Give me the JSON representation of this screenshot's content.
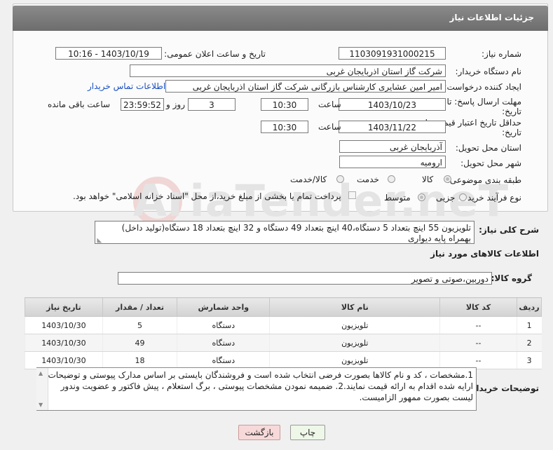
{
  "header": {
    "title": "جزئیات اطلاعات نیاز"
  },
  "form": {
    "need_number_label": "شماره نیاز:",
    "need_number": "1103091931000215",
    "announce_label": "تاریخ و ساعت اعلان عمومی:",
    "announce_value": "1403/10/19 - 10:16",
    "buyer_org_label": "نام دستگاه خریدار:",
    "buyer_org": "شرکت گاز استان اذربایجان غربی",
    "creator_label": "ایجاد کننده درخواست:",
    "creator": "امیر امین عشایری کارشناس بازرگانی شرکت گاز استان اذربایجان غربی",
    "contact_link": "اطلاعات تماس خریدار",
    "reply_deadline_label": "مهلت ارسال پاسخ: تا",
    "reply_deadline_label2": "تاریخ:",
    "reply_date": "1403/10/23",
    "time_label": "ساعت",
    "reply_time": "10:30",
    "days_count": "3",
    "days_label": "روز و",
    "remaining_time": "23:59:52",
    "remaining_label": "ساعت باقی مانده",
    "price_validity_label": "حداقل تاریخ اعتبار قیمت: تا",
    "price_validity_label2": "تاریخ:",
    "price_date": "1403/11/22",
    "price_time": "10:30",
    "province_label": "استان محل تحویل:",
    "province": "آذربایجان غربی",
    "city_label": "شهر محل تحویل:",
    "city": "ارومیه",
    "category_label": "طبقه بندی موضوعی:",
    "category_options": [
      "کالا",
      "خدمت",
      "کالا/خدمت"
    ],
    "process_label": "نوع فرآیند خرید :",
    "process_options": [
      "جزیی",
      "متوسط"
    ],
    "payment_note": "پرداخت تمام یا بخشی از مبلغ خرید،از محل \"اسناد خزانه اسلامی\" خواهد بود."
  },
  "description": {
    "label": "شرح کلی نیاز:",
    "text": "تلویزیون 55 اینچ بتعداد 5 دستگاه،40 اینچ بتعداد 49 دستگاه و 32 اینچ بتعداد 18 دستگاه(تولید داخل) بهمراه پایه دیواری"
  },
  "goods_section": {
    "title": "اطلاعات کالاهای مورد نیاز",
    "group_label": "گروه کالا:",
    "group_value": "دوربین،صوتی و تصویر",
    "columns": [
      "ردیف",
      "کد کالا",
      "نام کالا",
      "واحد شمارش",
      "تعداد / مقدار",
      "تاریخ نیاز"
    ],
    "rows": [
      [
        "1",
        "--",
        "تلویزیون",
        "دستگاه",
        "5",
        "1403/10/30"
      ],
      [
        "2",
        "--",
        "تلویزیون",
        "دستگاه",
        "49",
        "1403/10/30"
      ],
      [
        "3",
        "--",
        "تلویزیون",
        "دستگاه",
        "18",
        "1403/10/30"
      ]
    ]
  },
  "notes": {
    "label": "توضیحات خریدار:",
    "text": "1.مشخصات ، کد و نام کالاها بصورت فرضی انتخاب شده است و فروشندگان بایستی بر اساس مدارک پیوستی و توضیحات ارایه شده اقدام به ارائه قیمت نمایند.2. ضمیمه نمودن مشخصات پیوستی ، برگ استعلام ، پیش فاکتور و عضویت وندور لیست بصورت ممهور الزامیست."
  },
  "buttons": {
    "print": "چاپ",
    "back": "بازگشت"
  },
  "watermark": "AriaTender.neT",
  "colors": {
    "link": "#1a4fc0",
    "back_button": "#f7d9d9",
    "print_button": "#eef7e8"
  }
}
